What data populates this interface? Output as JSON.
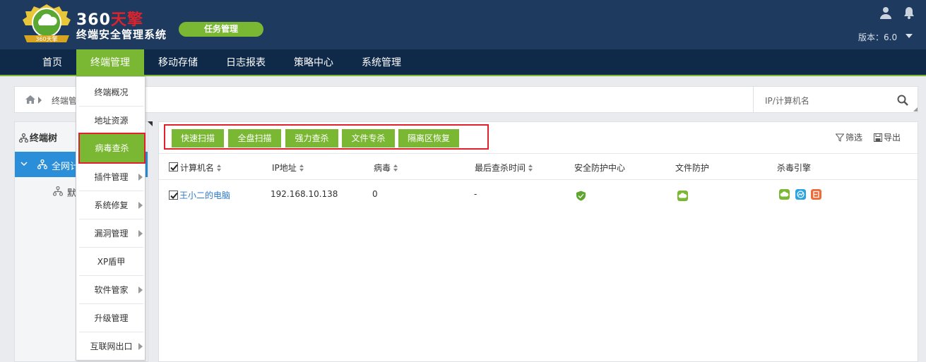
{
  "header": {
    "logo_badge_text": "360天擎",
    "title_prefix": "360",
    "title_suffix": "天擎",
    "subtitle": "终端安全管理系统",
    "task_button": "任务管理",
    "version": "版本：6.0"
  },
  "nav": {
    "items": [
      {
        "label": "首页"
      },
      {
        "label": "终端管理",
        "active": true
      },
      {
        "label": "移动存储"
      },
      {
        "label": "日志报表"
      },
      {
        "label": "策略中心"
      },
      {
        "label": "系统管理"
      }
    ]
  },
  "breadcrumb": {
    "text": "终端管"
  },
  "search": {
    "placeholder": "IP/计算机名"
  },
  "tree": {
    "title": "终端树",
    "root": "全网计",
    "child": "默"
  },
  "toolbar": {
    "buttons": [
      "快速扫描",
      "全盘扫描",
      "强力查杀",
      "文件专杀",
      "隔离区恢复"
    ],
    "filter": "筛选",
    "export": "导出"
  },
  "table": {
    "columns": [
      "计算机名",
      "IP地址",
      "病毒",
      "最后查杀时间",
      "安全防护中心",
      "文件防护",
      "杀毒引擎"
    ],
    "rows": [
      {
        "name": "王小二的电脑",
        "ip": "192.168.10.138",
        "virus": "0",
        "last_scan": "-",
        "checked": true
      }
    ]
  },
  "dropdown": {
    "items": [
      {
        "label": "终端概况",
        "submenu": false
      },
      {
        "label": "地址资源",
        "submenu": false
      },
      {
        "label": "病毒查杀",
        "submenu": false,
        "active": true
      },
      {
        "label": "插件管理",
        "submenu": true
      },
      {
        "label": "系统修复",
        "submenu": true
      },
      {
        "label": "漏洞管理",
        "submenu": true
      },
      {
        "label": "XP盾甲",
        "submenu": false
      },
      {
        "label": "软件管家",
        "submenu": true
      },
      {
        "label": "升级管理",
        "submenu": false
      },
      {
        "label": "互联网出口",
        "submenu": true
      }
    ]
  },
  "colors": {
    "header_bg": "#1e3a5f",
    "nav_bg": "#0f2a49",
    "accent_green": "#7ab833",
    "highlight_red": "#e0202a",
    "tree_active_blue": "#2a8fd8"
  },
  "icons": {
    "security_center": "shield-icon",
    "file_protection": "cloud-icon",
    "engines": [
      "cloud-engine-icon",
      "ai-engine-icon",
      "bd-engine-icon"
    ]
  }
}
